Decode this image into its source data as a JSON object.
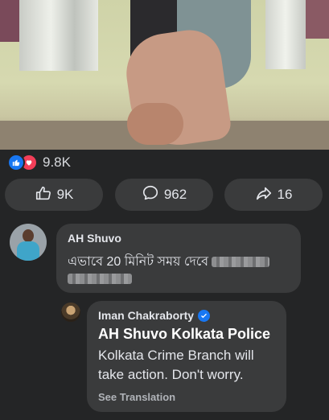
{
  "post": {
    "reactions_count": "9.8K",
    "reaction_icons": [
      "like-icon",
      "love-icon"
    ],
    "actions": {
      "like_count": "9K",
      "comment_count": "962",
      "share_count": "16"
    }
  },
  "comments": [
    {
      "author": "AH Shuvo",
      "text": "এভাবে 20 মিনিট সময় দেবে"
    }
  ],
  "reply": {
    "author": "Iman Chakraborty",
    "verified": true,
    "mention": "AH Shuvo Kolkata Police",
    "text": "Kolkata Crime Branch will take action. Don't worry.",
    "see_translation": "See Translation"
  },
  "colors": {
    "background": "#242526",
    "bubble": "#3a3b3c",
    "accent": "#1877f2",
    "love": "#f33e58"
  }
}
